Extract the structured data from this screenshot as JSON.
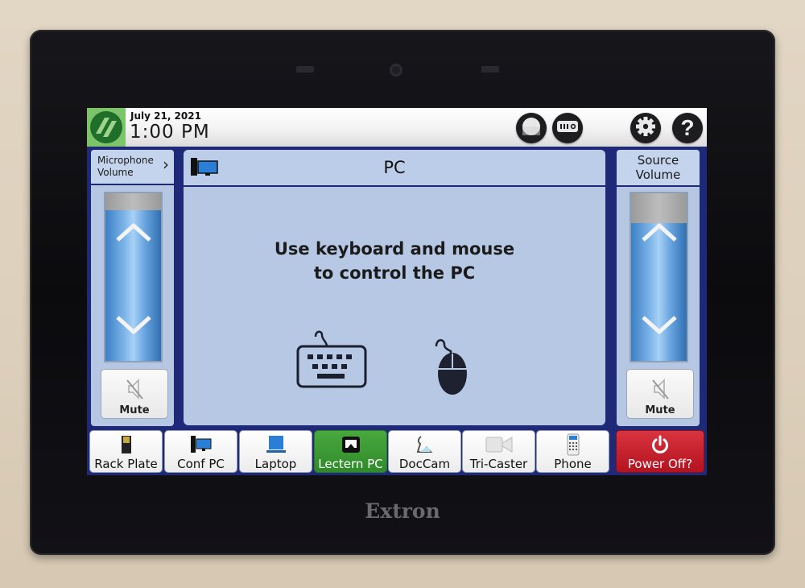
{
  "device": {
    "brand": "Extron"
  },
  "topbar": {
    "logo_icon": "extron-logo-icon",
    "date": "July 21, 2021",
    "time": "1:00 PM",
    "buttons": [
      {
        "name": "display-button",
        "icon": "display-icon"
      },
      {
        "name": "projector-button",
        "icon": "projector-icon"
      },
      {
        "name": "settings-button",
        "icon": "gear-icon"
      },
      {
        "name": "help-button",
        "icon": "question-icon"
      }
    ]
  },
  "mic_volume": {
    "title": "Microphone Volume",
    "level_fraction": 0.9,
    "mute_label": "Mute"
  },
  "source_volume": {
    "title_line1": "Source",
    "title_line2": "Volume",
    "level_fraction": 0.82,
    "mute_label": "Mute"
  },
  "main": {
    "title": "PC",
    "message_line1": "Use keyboard and mouse",
    "message_line2": "to control the PC"
  },
  "sources": [
    {
      "label": "Rack Plate",
      "icon": "rack-plate-icon",
      "active": false
    },
    {
      "label": "Conf PC",
      "icon": "desktop-pc-icon",
      "active": false
    },
    {
      "label": "Laptop",
      "icon": "laptop-icon",
      "active": false
    },
    {
      "label": "Lectern PC",
      "icon": "lectern-pc-icon",
      "active": true
    },
    {
      "label": "DocCam",
      "icon": "document-camera-icon",
      "active": false
    },
    {
      "label": "Tri-Caster",
      "icon": "video-camera-icon",
      "active": false
    },
    {
      "label": "Phone",
      "icon": "phone-icon",
      "active": false
    },
    {
      "label": "Power Off?",
      "icon": "power-icon",
      "active": false
    }
  ],
  "colors": {
    "active_source": "#3a9a33",
    "power": "#c41f2b",
    "frame_blue": "#1e2a78",
    "panel_blue": "#b6c8e4",
    "logo_green": "#7cc36a"
  }
}
